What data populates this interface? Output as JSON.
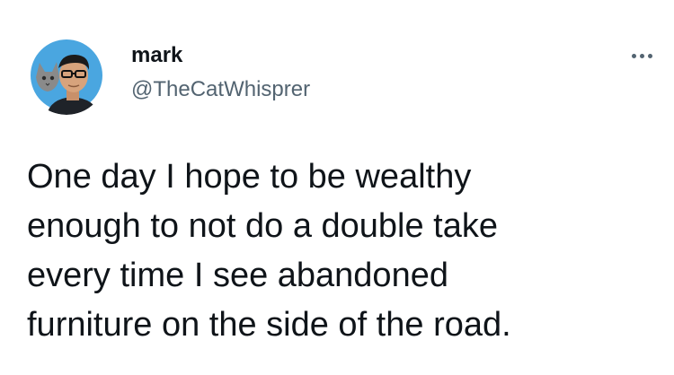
{
  "author": {
    "display_name": "mark",
    "handle": "@TheCatWhisprer",
    "avatar_icon": "profile-photo-with-cat",
    "avatar_bg": "#4aa6e0"
  },
  "more_icon": "ellipsis-icon",
  "tweet": {
    "text": "One day I hope to be wealthy\nenough to not do a double take\nevery time I see abandoned\nfurniture on the side of the road."
  }
}
